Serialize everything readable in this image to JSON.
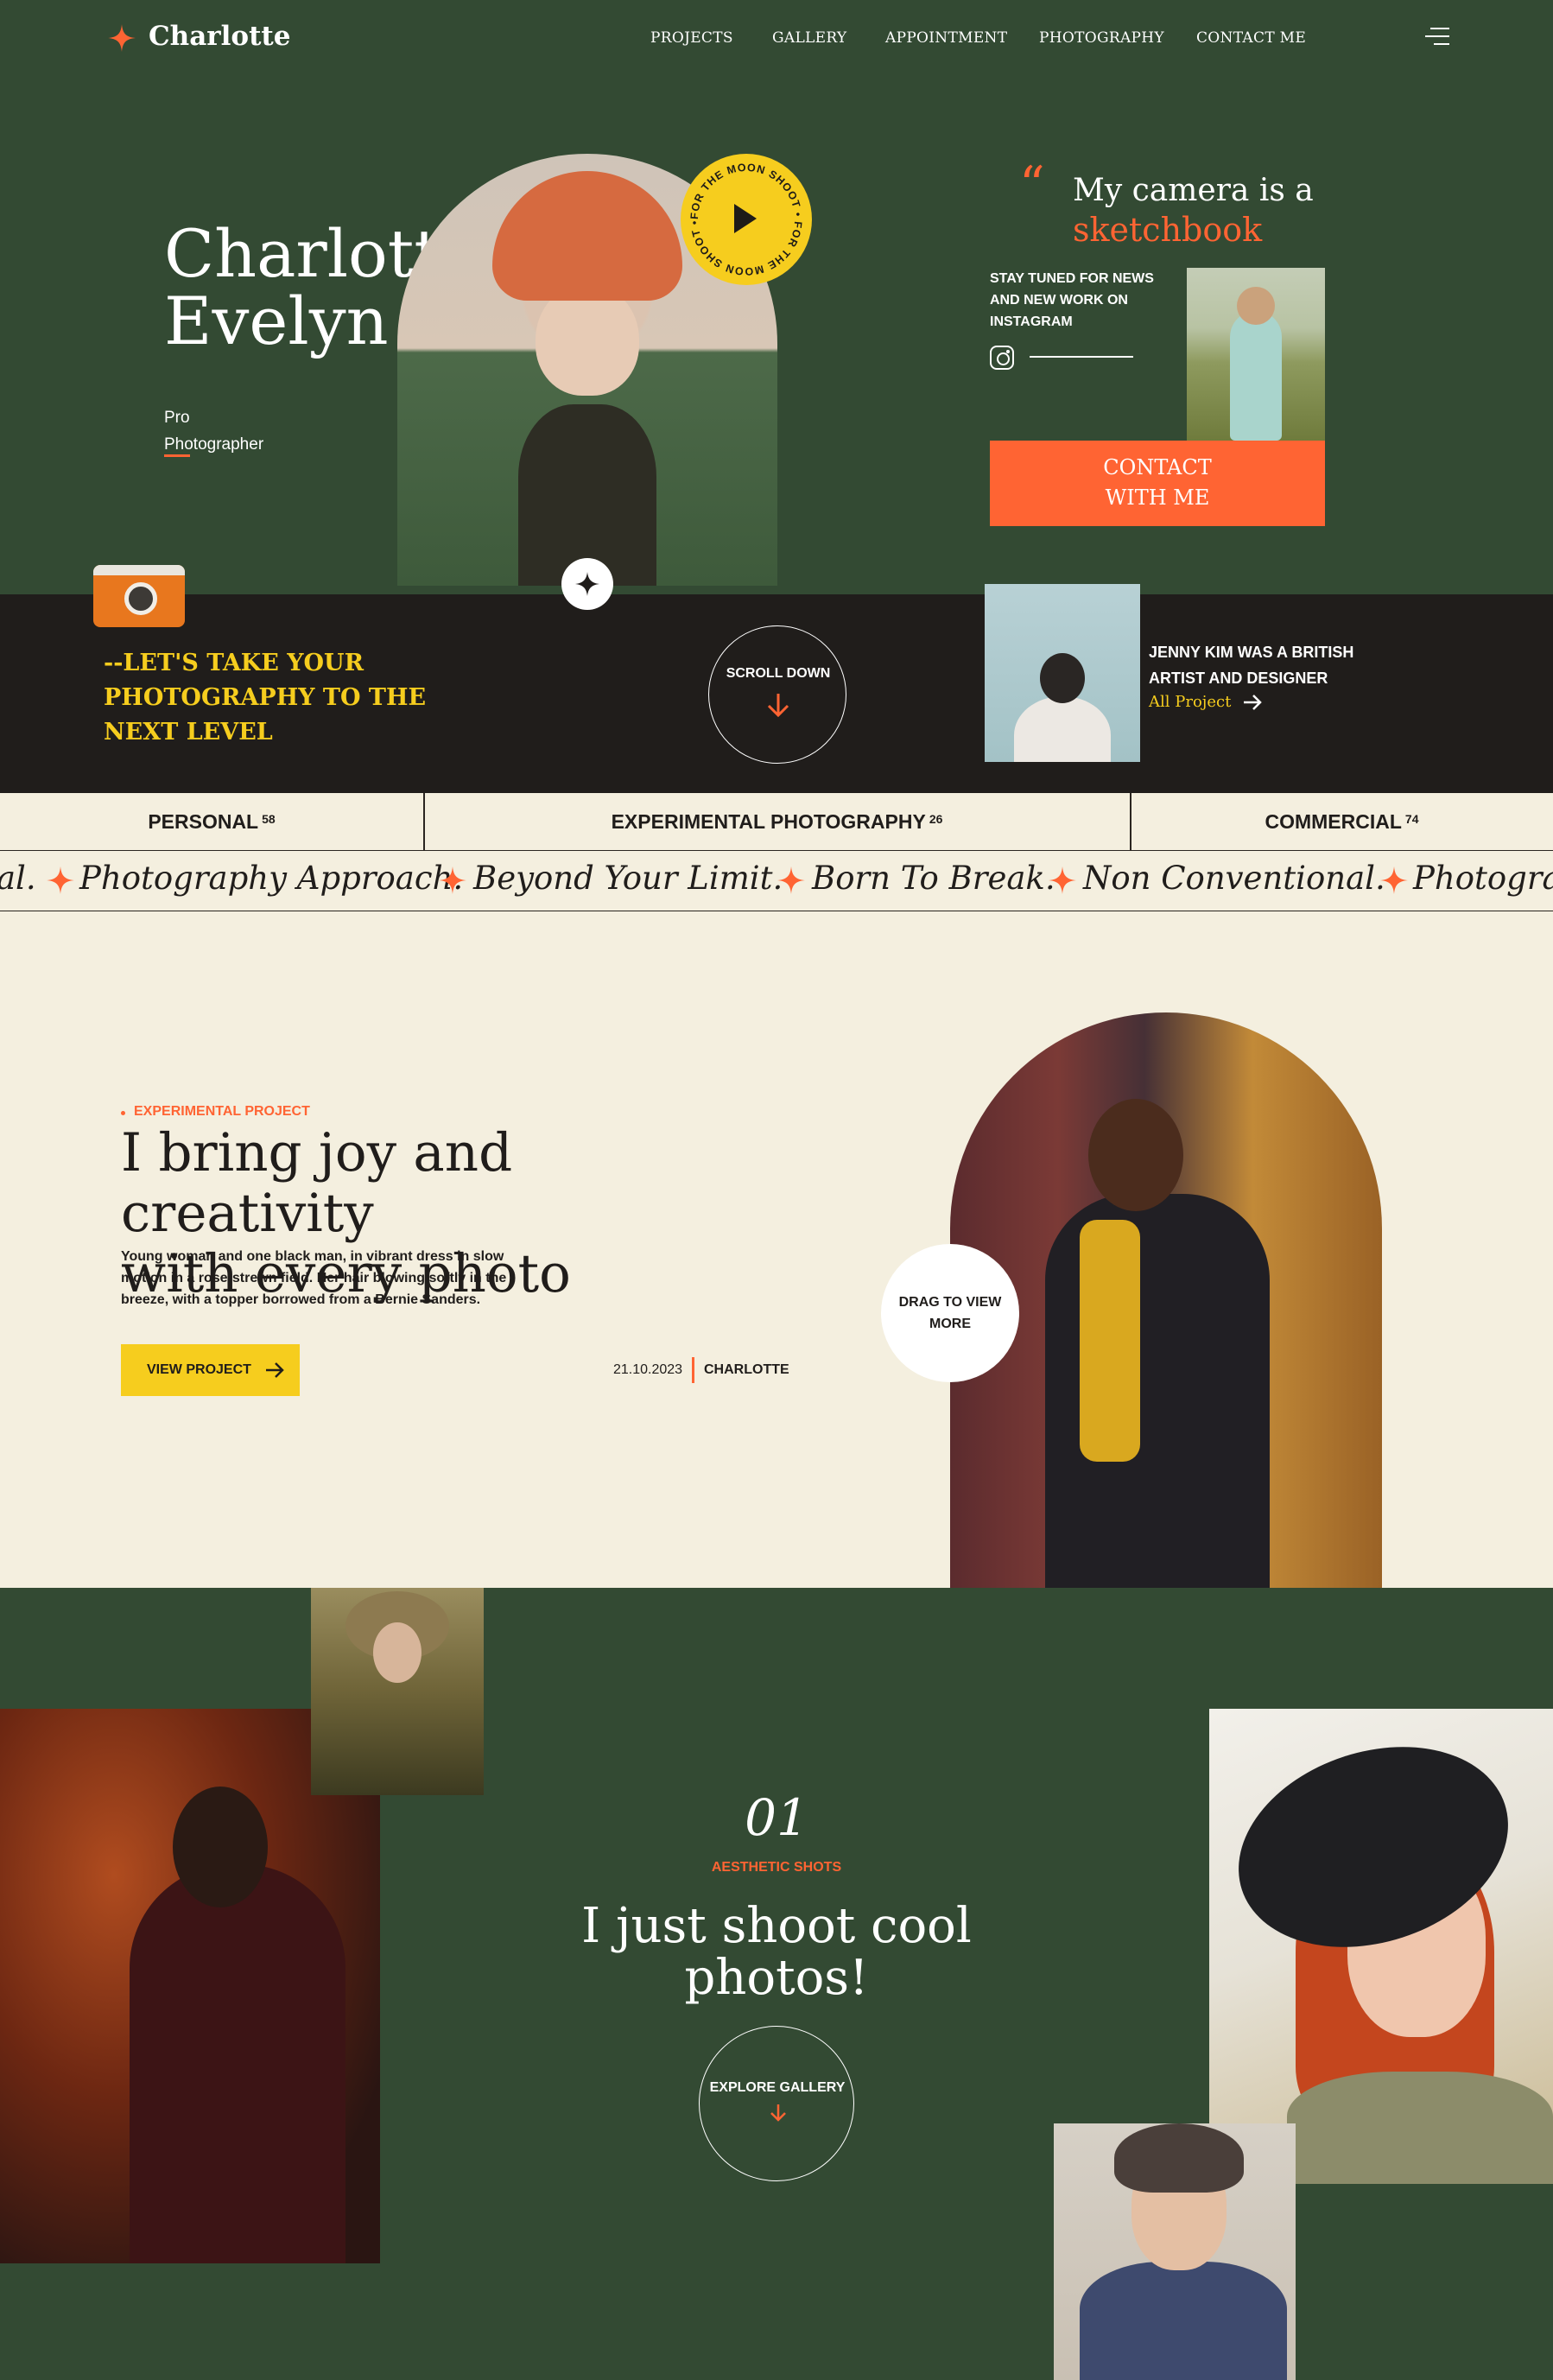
{
  "brand": {
    "name": "Charlotte"
  },
  "nav": {
    "items": [
      "PROJECTS",
      "GALLERY",
      "APPOINTMENT",
      "PHOTOGRAPHY",
      "CONTACT ME"
    ]
  },
  "hero": {
    "name_line1": "Charlotte",
    "name_line2": "Evelyn",
    "role_line1": "Pro",
    "role_line2": "Photographer",
    "badge_text": "FOR THE MOON SHOOT • FOR THE MOON SHOOT •",
    "quote_mark": "“",
    "quote_line1": "My camera is a",
    "quote_line2": "sketchbook",
    "stay_tuned": "STAY TUNED FOR NEWS AND NEW WORK ON INSTAGRAM",
    "contact_line1": "CONTACT",
    "contact_line2": "WITH ME"
  },
  "band": {
    "tagline": "--LET'S TAKE YOUR PHOTOGRAPHY TO THE NEXT LEVEL",
    "scroll_label": "SCROLL DOWN",
    "jenny_text": "JENNY KIM WAS A BRITISH ARTIST AND DESIGNER",
    "all_project": "All Project"
  },
  "categories": [
    {
      "label": "PERSONAL",
      "count": "58"
    },
    {
      "label": "EXPERIMENTAL PHOTOGRAPHY",
      "count": "26"
    },
    {
      "label": "COMMERCIAL",
      "count": "74"
    }
  ],
  "marquee": {
    "items": [
      "al.",
      "Photography Approach.",
      "Beyond Your Limit.",
      "Born To Break.",
      "Non Conventional.",
      "Photogra"
    ]
  },
  "project": {
    "label": "EXPERIMENTAL PROJECT",
    "title_line1": "I bring joy and creativity",
    "title_line2": "with every photo",
    "description": "Young woman and one black man, in vibrant dress in slow motion in a rose-strewn field. Her hair blowing softly in the breeze, with a topper borrowed from a Bernie Sanders.",
    "button": "VIEW PROJECT",
    "date": "21.10.2023",
    "author": "CHARLOTTE",
    "drag": "DRAG TO VIEW MORE"
  },
  "gallery": {
    "number": "01",
    "label": "AESTHETIC SHOTS",
    "title": "I just shoot cool photos!",
    "explore": "EXPLORE GALLERY"
  },
  "colors": {
    "green": "#334a33",
    "dark": "#201d1b",
    "cream": "#f4efdf",
    "orange": "#ff6433",
    "yellow": "#f6cd1e"
  }
}
